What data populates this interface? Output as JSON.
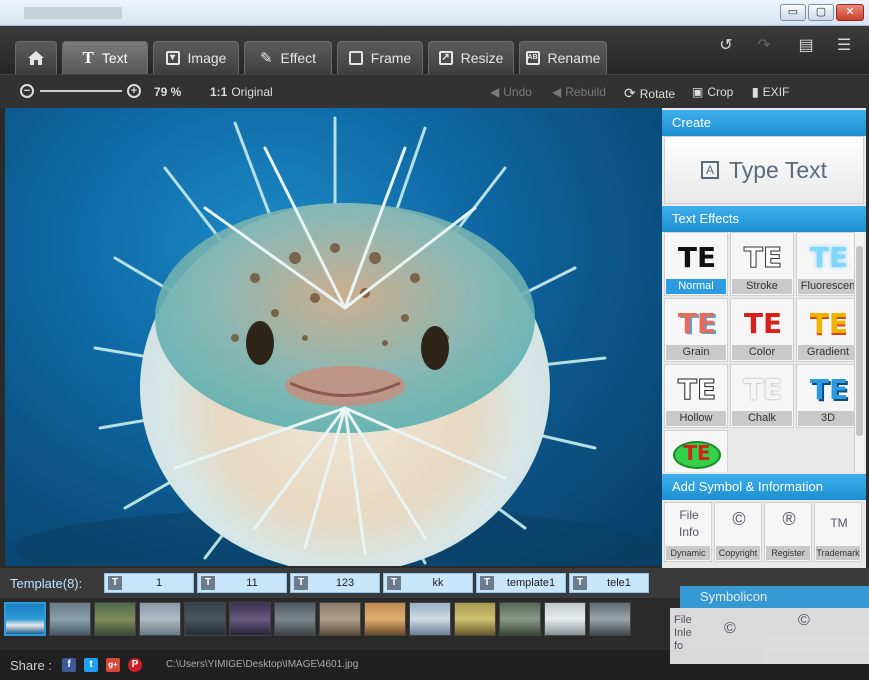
{
  "window": {
    "controls": {
      "minimize": "▭",
      "maximize": "▢",
      "close": "✕"
    }
  },
  "tabs": [
    {
      "label": "",
      "icon": "home-icon"
    },
    {
      "label": "Text",
      "icon": "text-icon"
    },
    {
      "label": "Image",
      "icon": "image-icon"
    },
    {
      "label": "Effect",
      "icon": "effect-icon"
    },
    {
      "label": "Frame",
      "icon": "frame-icon"
    },
    {
      "label": "Resize",
      "icon": "resize-icon"
    },
    {
      "label": "Rename",
      "icon": "rename-icon"
    }
  ],
  "toolbar_right_icons": [
    "undo-arrow-icon",
    "redo-arrow-icon",
    "feedback-icon",
    "menu-icon"
  ],
  "subbar": {
    "zoom": "79 %",
    "original_icon": "1:1",
    "original": "Original",
    "undo": "Undo",
    "rebuild": "Rebuild",
    "rotate": "Rotate",
    "crop": "Crop",
    "exif": "EXIF"
  },
  "panel": {
    "create_title": "Create",
    "type_text": "Type Text",
    "type_text_icon": "A",
    "effects_title": "Text Effects",
    "effects": [
      {
        "glyph": "TE",
        "label": "Normal",
        "color": "#111111"
      },
      {
        "glyph": "TE",
        "label": "Stroke",
        "color": "#ffffff"
      },
      {
        "glyph": "TE",
        "label": "Fluorescen",
        "color": "#7fd6ff"
      },
      {
        "glyph": "TE",
        "label": "Grain",
        "color": "#e86a5a"
      },
      {
        "glyph": "TE",
        "label": "Color",
        "color": "#d8201a"
      },
      {
        "glyph": "TE",
        "label": "Gradient",
        "color": "#f0b400"
      },
      {
        "glyph": "TE",
        "label": "Hollow",
        "color": "#ffffff"
      },
      {
        "glyph": "TE",
        "label": "Chalk",
        "color": "#f2f2f2"
      },
      {
        "glyph": "TE",
        "label": "3D",
        "color": "#2a9be0"
      },
      {
        "glyph": "TE",
        "label": "",
        "color": "#d8201a"
      }
    ],
    "symbol_title": "Add Symbol & Information",
    "symbols": [
      {
        "glyph": "File\nInfo",
        "label": "Dynamic"
      },
      {
        "glyph": "©",
        "label": "Copyright"
      },
      {
        "glyph": "®",
        "label": "Register"
      },
      {
        "glyph": "TM",
        "label": "Trademark"
      }
    ]
  },
  "templates": {
    "title": "Template(8):",
    "icon": "T",
    "items": [
      "1",
      "11",
      "123",
      "kk",
      "template1",
      "tele1"
    ]
  },
  "share": {
    "label": "Share :",
    "networks": [
      {
        "glyph": "f",
        "color": "#3b5998"
      },
      {
        "glyph": "t",
        "color": "#1da1f2"
      },
      {
        "glyph": "g+",
        "color": "#d34836"
      },
      {
        "glyph": "P",
        "color": "#cb2027"
      }
    ]
  },
  "path": "C:\\Users\\YIMIGE\\Desktop\\IMAGE\\4601.jpg",
  "ghost": {
    "title": "Symbolicon",
    "glyph1": "File\nInle\nfo",
    "glyph2": "©",
    "glyph3": "©"
  },
  "colors": {
    "accent": "#2d9be0",
    "toolbar": "#2b2b2b",
    "panel": "#e9e9e9"
  }
}
